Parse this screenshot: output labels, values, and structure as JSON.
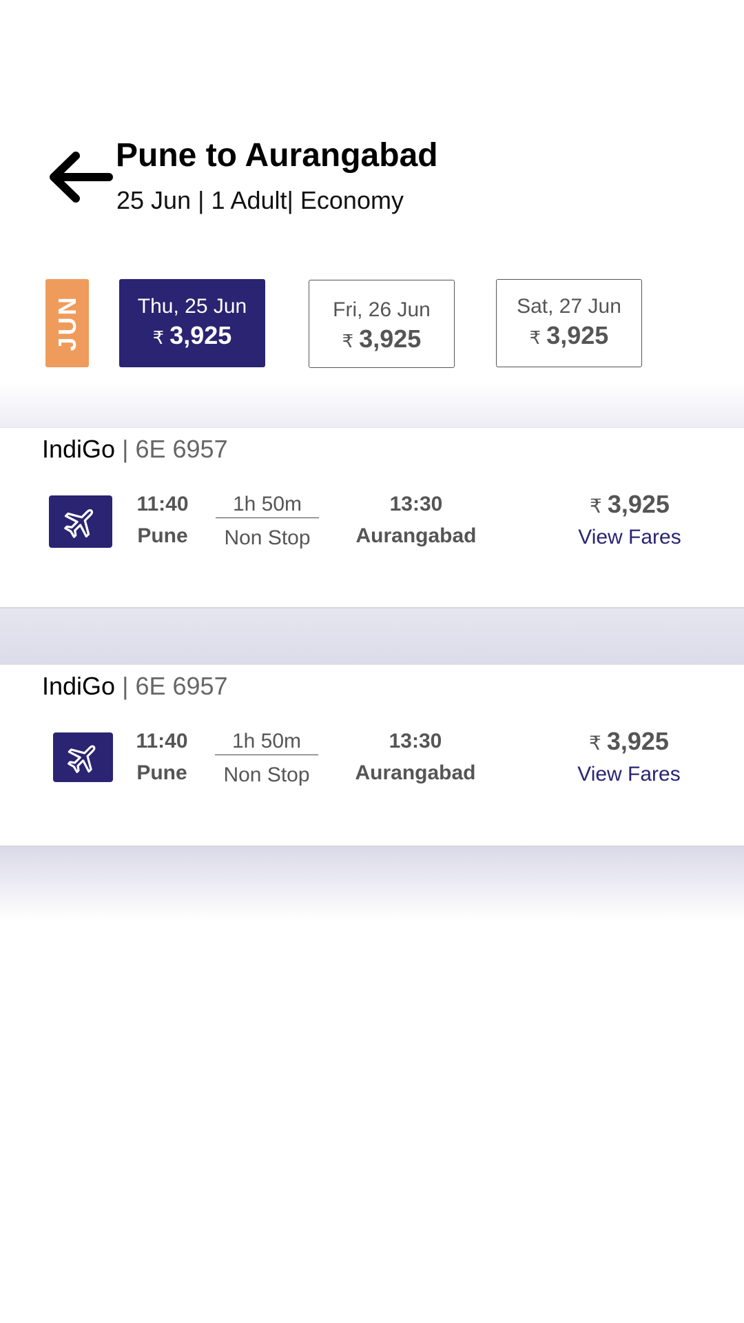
{
  "header": {
    "title": "Pune to Aurangabad",
    "subtitle": "25 Jun | 1 Adult| Economy"
  },
  "month_tag": "JUN",
  "dates": [
    {
      "label": "Thu, 25 Jun",
      "currency": "₹",
      "price": "3,925",
      "selected": true
    },
    {
      "label": "Fri, 26 Jun",
      "currency": "₹",
      "price": "3,925",
      "selected": false
    },
    {
      "label": "Sat, 27 Jun",
      "currency": "₹",
      "price": "3,925",
      "selected": false
    }
  ],
  "flights": [
    {
      "airline": "IndiGo",
      "separator": "|",
      "flight_no": "6E 6957",
      "dep_time": "11:40",
      "dep_city": "Pune",
      "duration": "1h 50m",
      "stops": "Non Stop",
      "arr_time": "13:30",
      "arr_city": "Aurangabad",
      "currency": "₹",
      "price": "3,925",
      "action": "View Fares"
    },
    {
      "airline": "IndiGo",
      "separator": "|",
      "flight_no": "6E 6957",
      "dep_time": "11:40",
      "dep_city": "Pune",
      "duration": "1h 50m",
      "stops": "Non Stop",
      "arr_time": "13:30",
      "arr_city": "Aurangabad",
      "currency": "₹",
      "price": "3,925",
      "action": "View Fares"
    }
  ],
  "icons": {
    "back": "arrow-left-icon",
    "flight": "airplane-icon"
  },
  "colors": {
    "primary": "#2a2472",
    "month_tag": "#ef9b5c",
    "text_muted": "#555555"
  }
}
